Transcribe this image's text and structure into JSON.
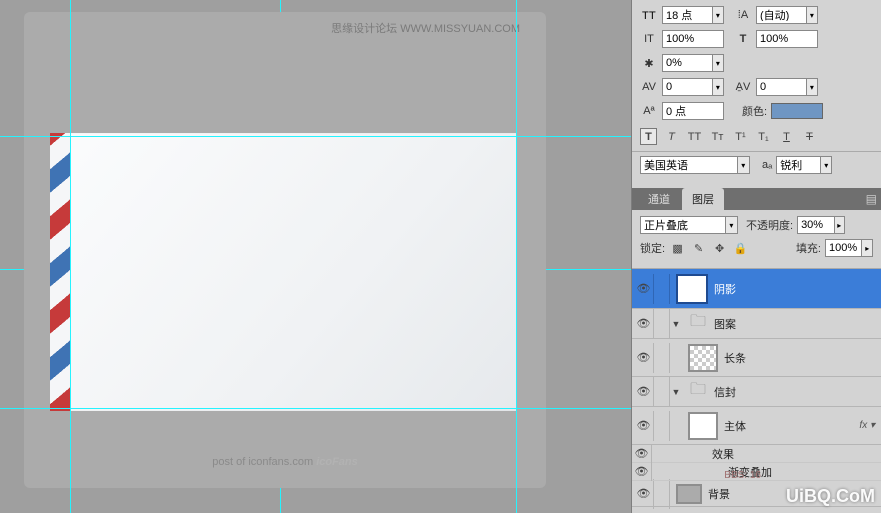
{
  "canvas": {
    "topbar": "思缘设计论坛 WWW.MISSYUAN.COM",
    "bottom_prefix": "post of ",
    "bottom_mid": "iconfans",
    "bottom_suffix": ".com",
    "bottom_brand": " icoFans"
  },
  "char": {
    "fontSize": "18 点",
    "leading": "(自动)",
    "vscale": "100%",
    "hscale": "100%",
    "tracking": "0%",
    "av1": "0",
    "av2": "0",
    "baseline": "0 点",
    "colorLabel": "颜色:",
    "swatch": "#6f96c3",
    "lang": "美国英语",
    "aa_prefix": "aₐ",
    "aa": "锐利"
  },
  "tabs": {
    "channels": "通道",
    "layers": "图层"
  },
  "layerOpts": {
    "blend": "正片叠底",
    "opacityLabel": "不透明度:",
    "opacity": "30%",
    "lockLabel": "锁定:",
    "fillLabel": "填充:",
    "fill": "100%"
  },
  "layers": [
    {
      "name": "阴影",
      "sel": true,
      "thumb": "white"
    },
    {
      "name": "图案",
      "group": true
    },
    {
      "name": "长条",
      "thumb": "checker",
      "indent": 2
    },
    {
      "name": "信封",
      "group": true,
      "indent": 1
    },
    {
      "name": "主体",
      "thumb": "white",
      "indent": 2,
      "fx": true
    },
    {
      "name": "背景",
      "thumb": "gray",
      "indent": 0
    }
  ],
  "fx": {
    "effects": "效果",
    "grad": "渐变叠加"
  },
  "watermark": "UiBQ.CoM",
  "bbs": "BBS: 16"
}
